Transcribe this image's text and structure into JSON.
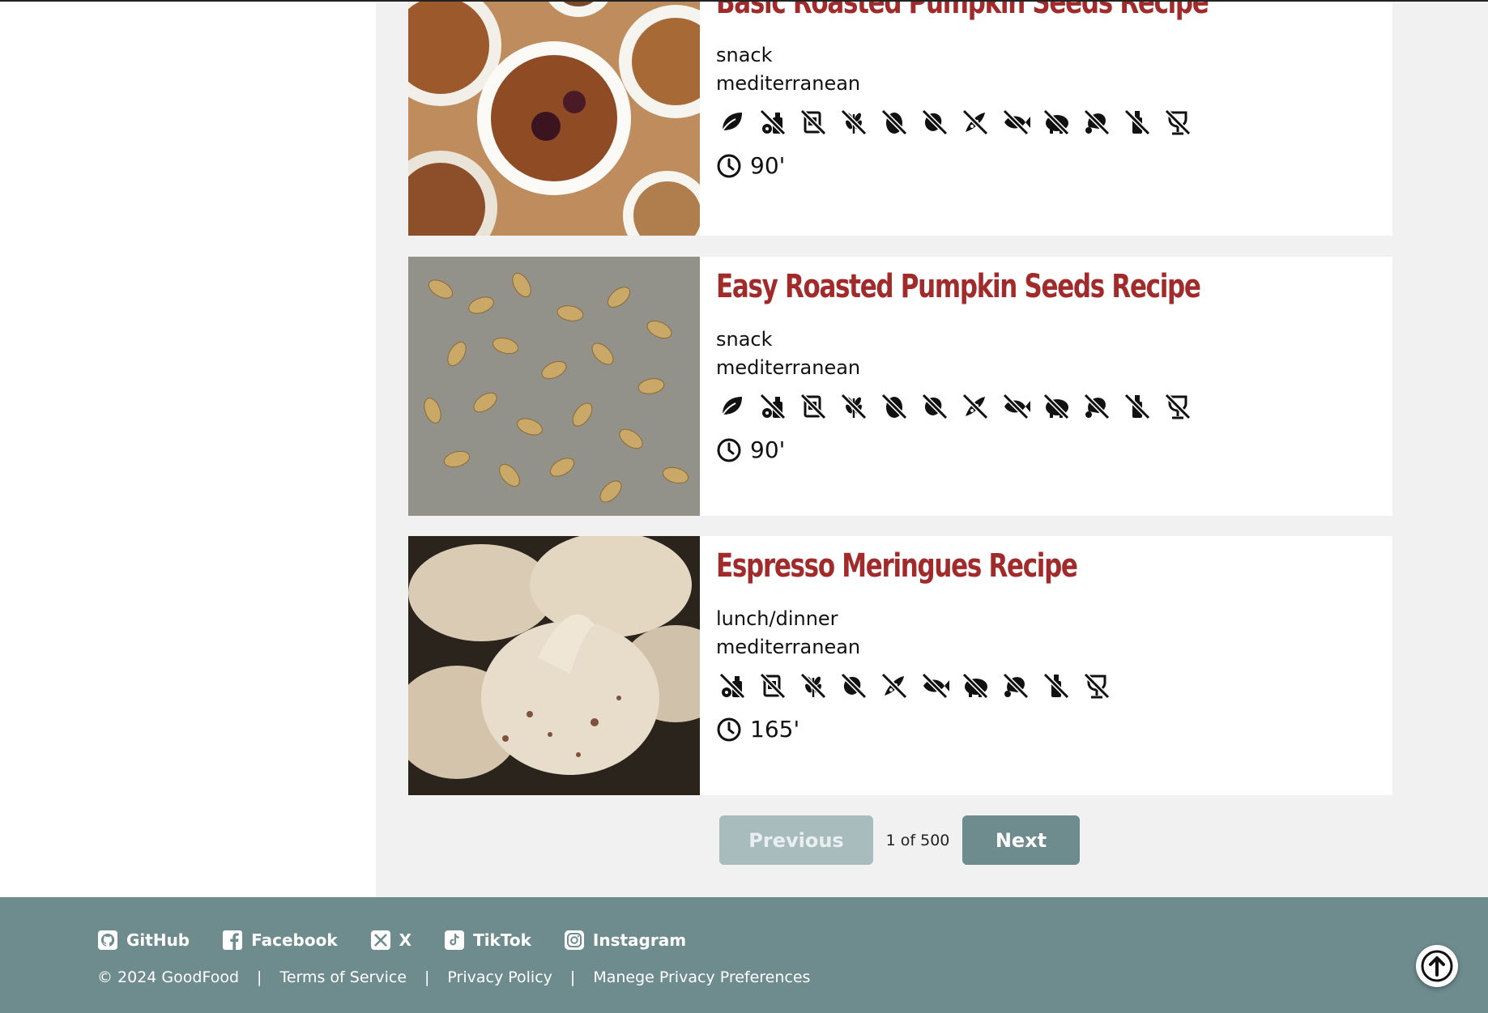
{
  "recipes": [
    {
      "title": "Basic Roasted Pumpkin Seeds Recipe",
      "meal_type": "snack",
      "cuisine": "mediterranean",
      "diet_icons": [
        "vegan-icon",
        "dairy-free-icon",
        "no-added-sugar-icon",
        "gluten-free-icon",
        "egg-free-icon",
        "nut-free-icon",
        "soy-free-icon",
        "fish-free-icon",
        "pork-free-icon",
        "meat-free-icon",
        "no-oil-icon",
        "alcohol-free-icon"
      ],
      "time": "90'"
    },
    {
      "title": "Easy Roasted Pumpkin Seeds Recipe",
      "meal_type": "snack",
      "cuisine": "mediterranean",
      "diet_icons": [
        "vegan-icon",
        "dairy-free-icon",
        "no-added-sugar-icon",
        "gluten-free-icon",
        "egg-free-icon",
        "nut-free-icon",
        "soy-free-icon",
        "fish-free-icon",
        "pork-free-icon",
        "meat-free-icon",
        "no-oil-icon",
        "alcohol-free-icon"
      ],
      "time": "90'"
    },
    {
      "title": "Espresso Meringues Recipe",
      "meal_type": "lunch/dinner",
      "cuisine": "mediterranean",
      "diet_icons": [
        "dairy-free-icon",
        "no-added-sugar-icon",
        "gluten-free-icon",
        "nut-free-icon",
        "soy-free-icon",
        "fish-free-icon",
        "pork-free-icon",
        "meat-free-icon",
        "no-oil-icon",
        "alcohol-free-icon"
      ],
      "time": "165'"
    }
  ],
  "pagination": {
    "previous_label": "Previous",
    "indicator": "1 of 500",
    "next_label": "Next"
  },
  "footer": {
    "social": [
      {
        "label": "GitHub",
        "icon": "github-icon"
      },
      {
        "label": "Facebook",
        "icon": "facebook-icon"
      },
      {
        "label": "X",
        "icon": "x-icon"
      },
      {
        "label": "TikTok",
        "icon": "tiktok-icon"
      },
      {
        "label": "Instagram",
        "icon": "instagram-icon"
      }
    ],
    "copyright": "© 2024 GoodFood",
    "separator": "|",
    "terms": "Terms of Service",
    "privacy": "Privacy Policy",
    "privacy_prefs": "Manege Privacy Preferences"
  },
  "colors": {
    "title": "#a12a2a",
    "footer": "#6e8b8e",
    "next_button": "#6e8b8e",
    "prev_button": "#a8bcbe"
  }
}
